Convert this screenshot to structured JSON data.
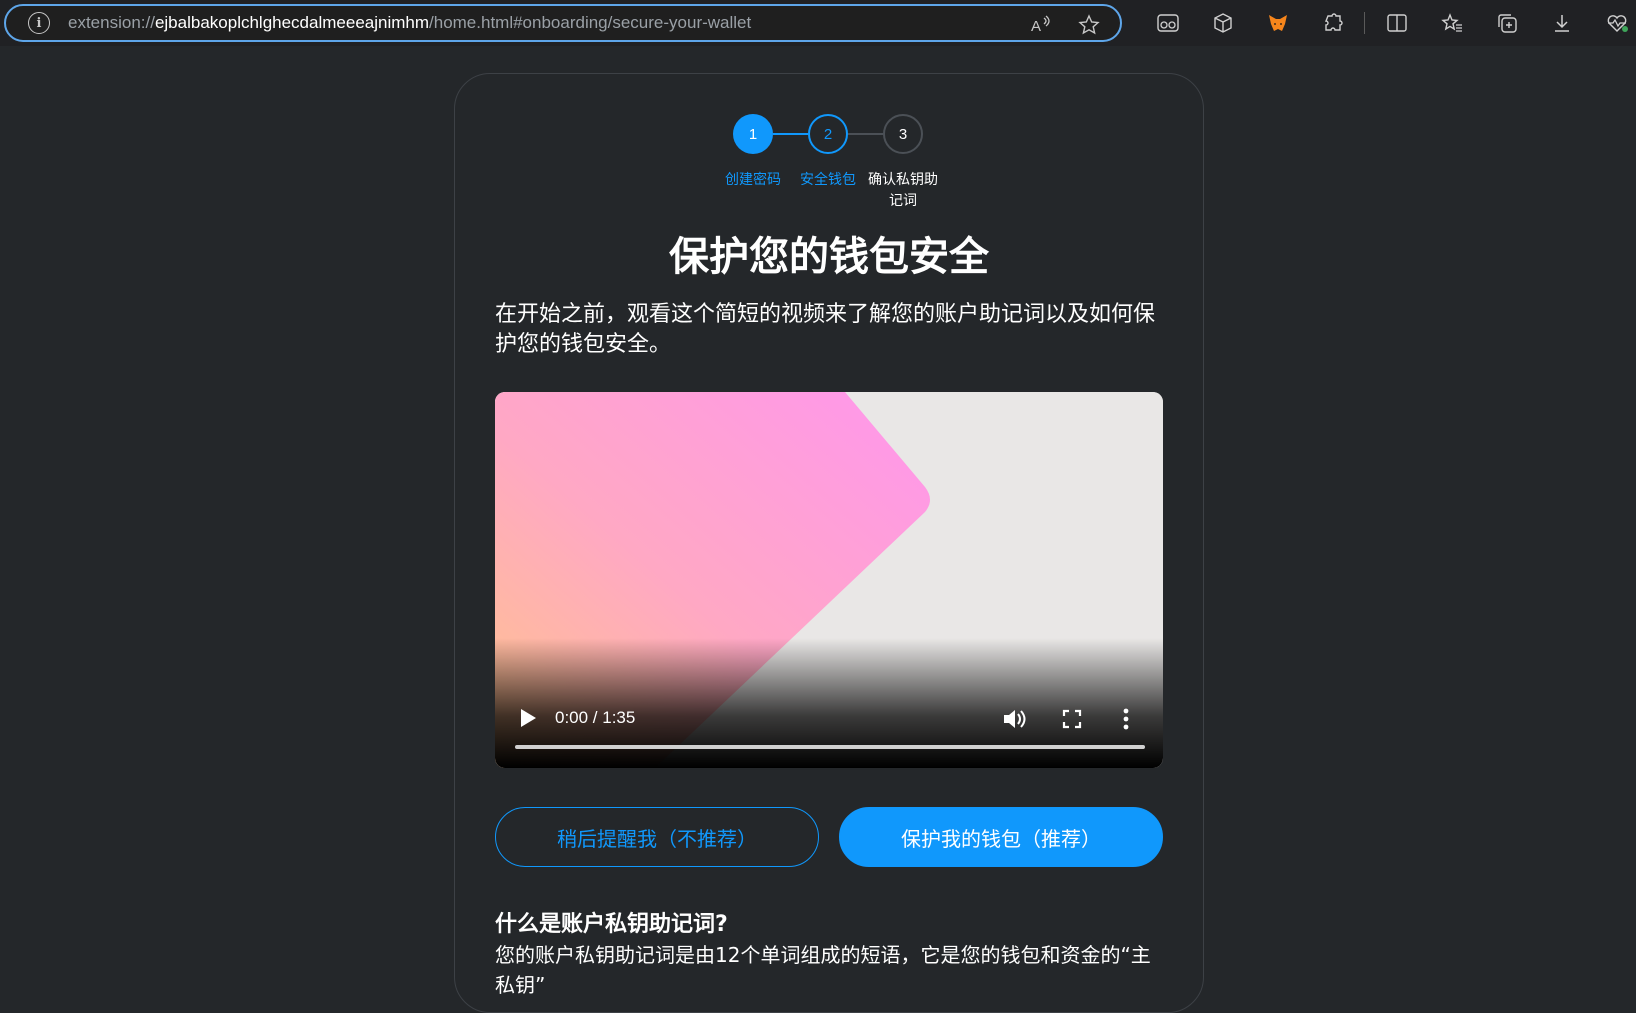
{
  "browser": {
    "url_scheme": "extension://",
    "url_host": "ejbalbakoplchlghecdalmeeeajnimhm",
    "url_path": "/home.html#onboarding/secure-your-wallet",
    "icons": [
      "read-aloud-icon",
      "favorite-star-icon",
      "reader-mode-icon",
      "cube-extension-icon",
      "metamask-fox-icon",
      "extensions-icon",
      "split-screen-icon",
      "favorites-icon",
      "collections-icon",
      "downloads-icon",
      "browser-essentials-icon"
    ]
  },
  "stepper": {
    "steps": [
      {
        "number": "1",
        "label": "创建密码"
      },
      {
        "number": "2",
        "label": "安全钱包"
      },
      {
        "number": "3",
        "label": "确认私钥助",
        "label_line2": "记词"
      }
    ]
  },
  "title": "保护您的钱包安全",
  "description": "在开始之前，观看这个简短的视频来了解您的账户助记词以及如何保护您的钱包安全。",
  "video": {
    "time": "0:00 / 1:35",
    "progress": 0
  },
  "buttons": {
    "remind_later": "稍后提醒我（不推荐）",
    "secure_wallet": "保护我的钱包（推荐）"
  },
  "faq": {
    "title": "什么是账户私钥助记词?",
    "text": "您的账户私钥助记词是由12个单词组成的短语，它是您的钱包和资金的“主私钥”"
  },
  "colors": {
    "accent": "#1098fc",
    "background": "#24272a"
  }
}
